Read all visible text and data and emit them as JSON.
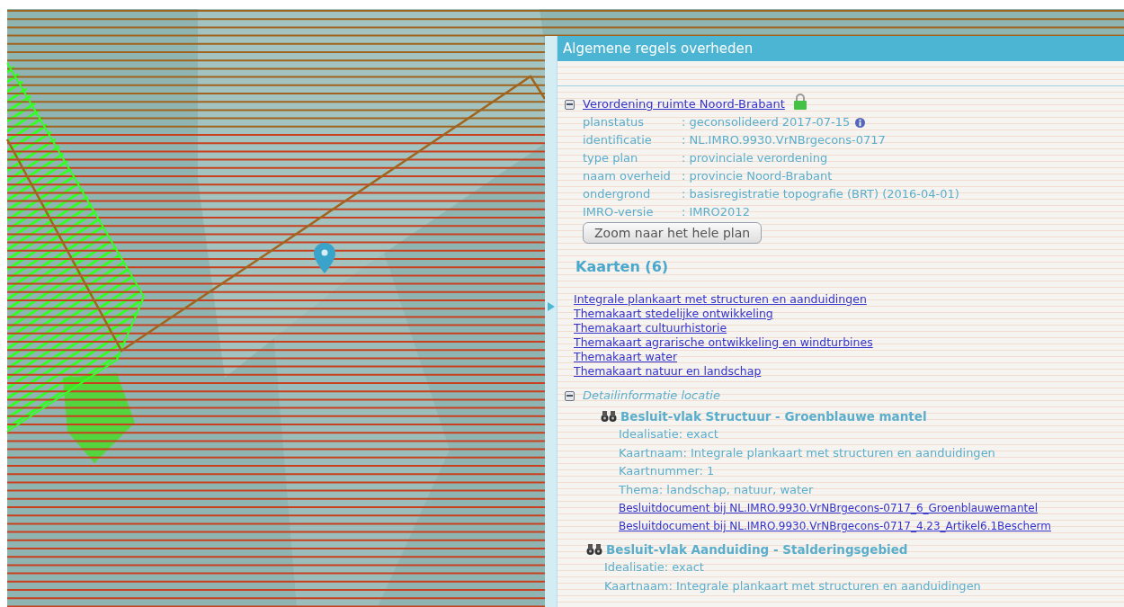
{
  "panel": {
    "title": "Algemene regels overheden",
    "plan": {
      "name": "Verordening ruimte Noord-Brabant",
      "expanded": true,
      "fields": [
        {
          "label": "planstatus",
          "value": ": geconsolideerd 2017-07-15",
          "info": true
        },
        {
          "label": "identificatie",
          "value": ": NL.IMRO.9930.VrNBrgecons-0717",
          "info": false
        },
        {
          "label": "type plan",
          "value": ": provinciale verordening",
          "info": false
        },
        {
          "label": "naam overheid",
          "value": ": provincie Noord-Brabant",
          "info": false
        },
        {
          "label": "ondergrond",
          "value": ": basisregistratie topografie (BRT) (2016-04-01)",
          "info": false
        },
        {
          "label": "IMRO-versie",
          "value": ": IMRO2012",
          "info": false
        }
      ],
      "button": "Zoom naar het hele plan"
    },
    "kaarten": {
      "heading": "Kaarten (6)",
      "links": [
        "Integrale plankaart met structuren en aanduidingen",
        "Themakaart stedelijke ontwikkeling",
        "Themakaart cultuurhistorie",
        "Themakaart agrarische ontwikkeling en windturbines",
        "Themakaart water",
        "Themakaart natuur en landschap"
      ]
    },
    "detail": {
      "heading": "Detailinformatie locatie",
      "expanded": true,
      "items": [
        {
          "title": "Besluit-vlak Structuur - Groenblauwe mantel",
          "lines": [
            "Idealisatie: exact",
            "Kaartnaam: Integrale plankaart met structuren en aanduidingen",
            "Kaartnummer: 1",
            "Thema: landschap, natuur, water"
          ],
          "links": [
            "Besluitdocument bij NL.IMRO.9930.VrNBrgecons-0717_6_Groenblauwemantel",
            "Besluitdocument bij NL.IMRO.9930.VrNBrgecons-0717_4.23_Artikel6.1Bescherm"
          ]
        },
        {
          "title": "Besluit-vlak Aanduiding - Stalderingsgebied",
          "lines": [
            "Idealisatie: exact",
            "Kaartnaam: Integrale plankaart met structuren en aanduidingen"
          ]
        }
      ]
    }
  }
}
